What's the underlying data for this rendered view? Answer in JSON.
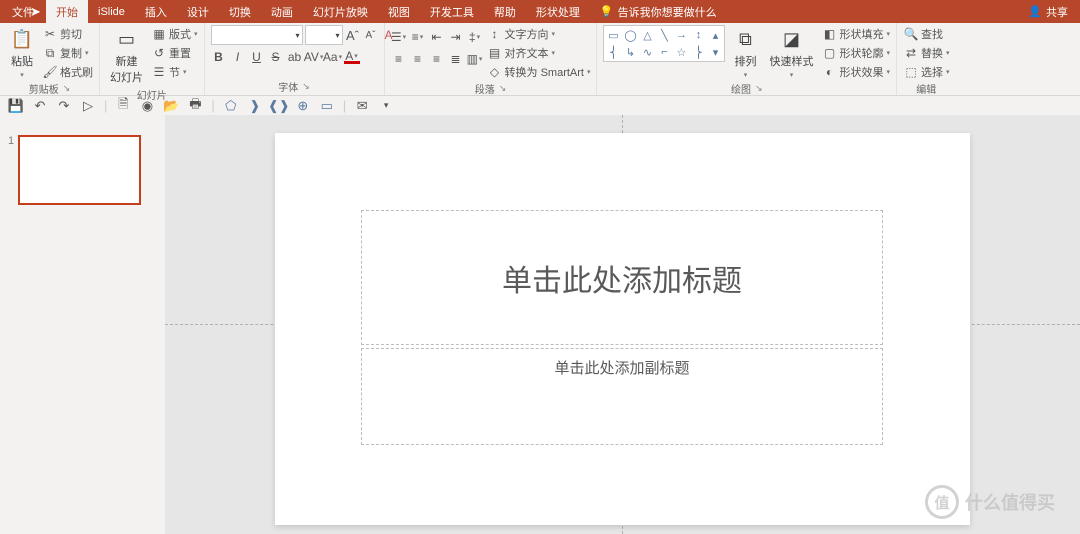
{
  "titlebar": {
    "tabs": [
      "文件",
      "开始",
      "iSlide",
      "插入",
      "设计",
      "切换",
      "动画",
      "幻灯片放映",
      "视图",
      "开发工具",
      "帮助",
      "形状处理"
    ],
    "active_index": 1,
    "tell_me_icon": "lightbulb-icon",
    "tell_me_text": "告诉我你想要做什么",
    "share_icon": "share-icon",
    "share_label": "共享"
  },
  "ribbon": {
    "clipboard": {
      "paste_icon": "clipboard-icon",
      "paste_label": "粘贴",
      "cut_icon": "scissors-icon",
      "cut_label": "剪切",
      "copy_icon": "copy-icon",
      "copy_label": "复制",
      "painter_icon": "format-painter-icon",
      "painter_label": "格式刷",
      "group_label": "剪贴板"
    },
    "slides": {
      "new_slide_icon": "new-slide-icon",
      "new_slide_label": "新建\n幻灯片",
      "layout_icon": "layout-icon",
      "layout_label": "版式",
      "reset_icon": "reset-icon",
      "reset_label": "重置",
      "section_icon": "section-icon",
      "section_label": "节",
      "group_label": "幻灯片"
    },
    "font": {
      "name_value": "",
      "size_value": "",
      "inc_font": "A",
      "dec_font": "A",
      "clear_fmt": "A",
      "quick_style": "A",
      "group_label": "字体"
    },
    "paragraph": {
      "text_dir_label": "文字方向",
      "align_text_label": "对齐文本",
      "smartart_label": "转换为 SmartArt",
      "group_label": "段落"
    },
    "drawing": {
      "arrange_label": "排列",
      "quick_style_label": "快速样式",
      "shape_fill_label": "形状填充",
      "shape_outline_label": "形状轮廓",
      "shape_effects_label": "形状效果",
      "group_label": "绘图"
    },
    "editing": {
      "find_label": "查找",
      "replace_label": "替换",
      "select_label": "选择",
      "group_label": "编辑"
    }
  },
  "qat": {
    "icons": [
      "save-icon",
      "undo-icon",
      "redo-icon",
      "start-from-beginning-icon",
      "new-file-icon",
      "touch-mode-icon",
      "open-file-icon",
      "quick-print-icon",
      "pentagon-icon",
      "right-brace-icon",
      "double-brace-icon",
      "add-shape-icon",
      "rounded-rect-icon",
      "email-icon",
      "customize-icon"
    ]
  },
  "thumbnails": {
    "current_number": "1"
  },
  "slide": {
    "title_placeholder": "单击此处添加标题",
    "subtitle_placeholder": "单击此处添加副标题"
  },
  "watermark": {
    "badge": "值",
    "text": "什么值得买"
  }
}
